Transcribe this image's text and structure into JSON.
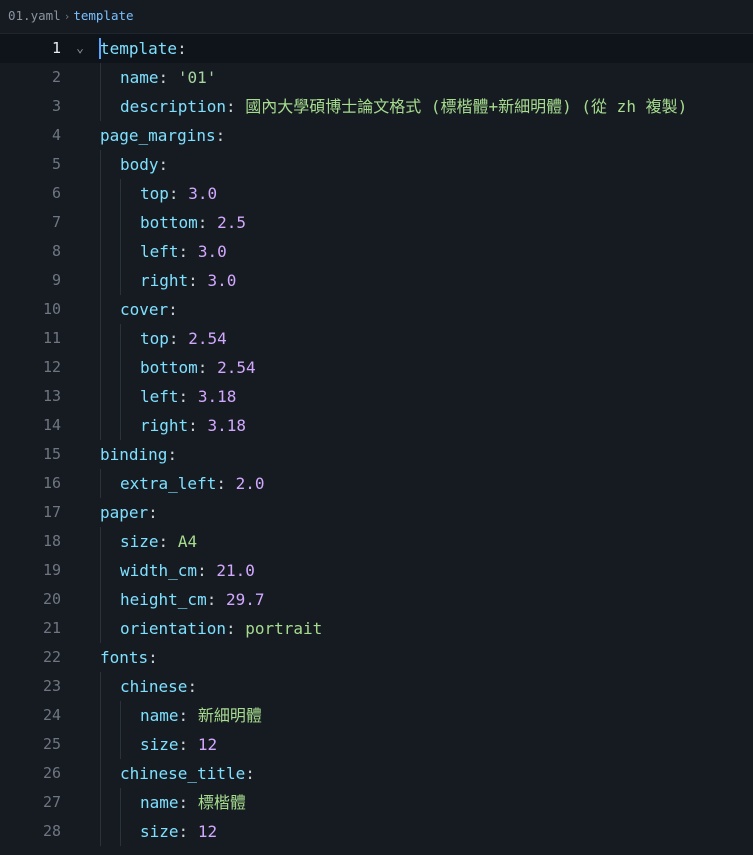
{
  "breadcrumb": {
    "file": "01.yaml",
    "separator": "›",
    "symbol": "template"
  },
  "active_line": 1,
  "lines": [
    {
      "num": "1",
      "indent": 0,
      "key": "template",
      "fold": "⌄"
    },
    {
      "num": "2",
      "indent": 1,
      "key": "name",
      "value": "'01'",
      "vtype": "str"
    },
    {
      "num": "3",
      "indent": 1,
      "key": "description",
      "value": "國內大學碩博士論文格式 (標楷體+新細明體) (從 zh 複製)",
      "vtype": "plain"
    },
    {
      "num": "4",
      "indent": 0,
      "key": "page_margins"
    },
    {
      "num": "5",
      "indent": 1,
      "key": "body"
    },
    {
      "num": "6",
      "indent": 2,
      "key": "top",
      "value": "3.0",
      "vtype": "num"
    },
    {
      "num": "7",
      "indent": 2,
      "key": "bottom",
      "value": "2.5",
      "vtype": "num"
    },
    {
      "num": "8",
      "indent": 2,
      "key": "left",
      "value": "3.0",
      "vtype": "num"
    },
    {
      "num": "9",
      "indent": 2,
      "key": "right",
      "value": "3.0",
      "vtype": "num"
    },
    {
      "num": "10",
      "indent": 1,
      "key": "cover"
    },
    {
      "num": "11",
      "indent": 2,
      "key": "top",
      "value": "2.54",
      "vtype": "num"
    },
    {
      "num": "12",
      "indent": 2,
      "key": "bottom",
      "value": "2.54",
      "vtype": "num"
    },
    {
      "num": "13",
      "indent": 2,
      "key": "left",
      "value": "3.18",
      "vtype": "num"
    },
    {
      "num": "14",
      "indent": 2,
      "key": "right",
      "value": "3.18",
      "vtype": "num"
    },
    {
      "num": "15",
      "indent": 0,
      "key": "binding"
    },
    {
      "num": "16",
      "indent": 1,
      "key": "extra_left",
      "value": "2.0",
      "vtype": "num"
    },
    {
      "num": "17",
      "indent": 0,
      "key": "paper"
    },
    {
      "num": "18",
      "indent": 1,
      "key": "size",
      "value": "A4",
      "vtype": "plain"
    },
    {
      "num": "19",
      "indent": 1,
      "key": "width_cm",
      "value": "21.0",
      "vtype": "num"
    },
    {
      "num": "20",
      "indent": 1,
      "key": "height_cm",
      "value": "29.7",
      "vtype": "num"
    },
    {
      "num": "21",
      "indent": 1,
      "key": "orientation",
      "value": "portrait",
      "vtype": "plain"
    },
    {
      "num": "22",
      "indent": 0,
      "key": "fonts"
    },
    {
      "num": "23",
      "indent": 1,
      "key": "chinese"
    },
    {
      "num": "24",
      "indent": 2,
      "key": "name",
      "value": "新細明體",
      "vtype": "plain"
    },
    {
      "num": "25",
      "indent": 2,
      "key": "size",
      "value": "12",
      "vtype": "num"
    },
    {
      "num": "26",
      "indent": 1,
      "key": "chinese_title"
    },
    {
      "num": "27",
      "indent": 2,
      "key": "name",
      "value": "標楷體",
      "vtype": "plain"
    },
    {
      "num": "28",
      "indent": 2,
      "key": "size",
      "value": "12",
      "vtype": "num"
    }
  ]
}
